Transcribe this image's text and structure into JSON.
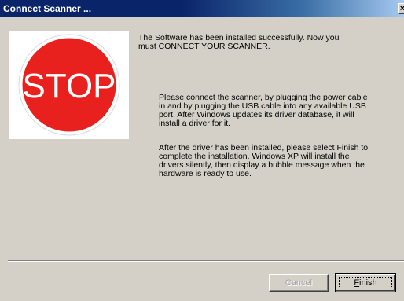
{
  "window": {
    "title": "Connect Scanner ...",
    "close_glyph": "×"
  },
  "graphic": {
    "icon": "stop-sign-icon",
    "sign_text": "STOP",
    "sign_color": "#e8211f",
    "sign_border": "#ffffff"
  },
  "message": {
    "intro_line1": "The Software has been installed successfully.  Now you",
    "intro_line2": "must CONNECT YOUR SCANNER.",
    "connect_line1": "Please connect the scanner, by plugging the power cable",
    "connect_line2": "in and by plugging the USB cable into any available USB",
    "connect_line3": "port. After Windows updates its driver database, it will",
    "connect_line4": "install a driver for it.",
    "after_line1": "After the driver has been installed, please select Finish to",
    "after_line2": "complete the installation.  Windows XP will install the",
    "after_line3": "drivers silently, then display a bubble message when the",
    "after_line4": "hardware is ready to use."
  },
  "buttons": {
    "cancel_label": "Cancel",
    "cancel_enabled": false,
    "finish_mnemonic": "F",
    "finish_rest": "inish"
  },
  "colors": {
    "dialog_bg": "#d4d0c8",
    "titlebar_start": "#0a246a",
    "titlebar_end": "#a6caf0"
  }
}
